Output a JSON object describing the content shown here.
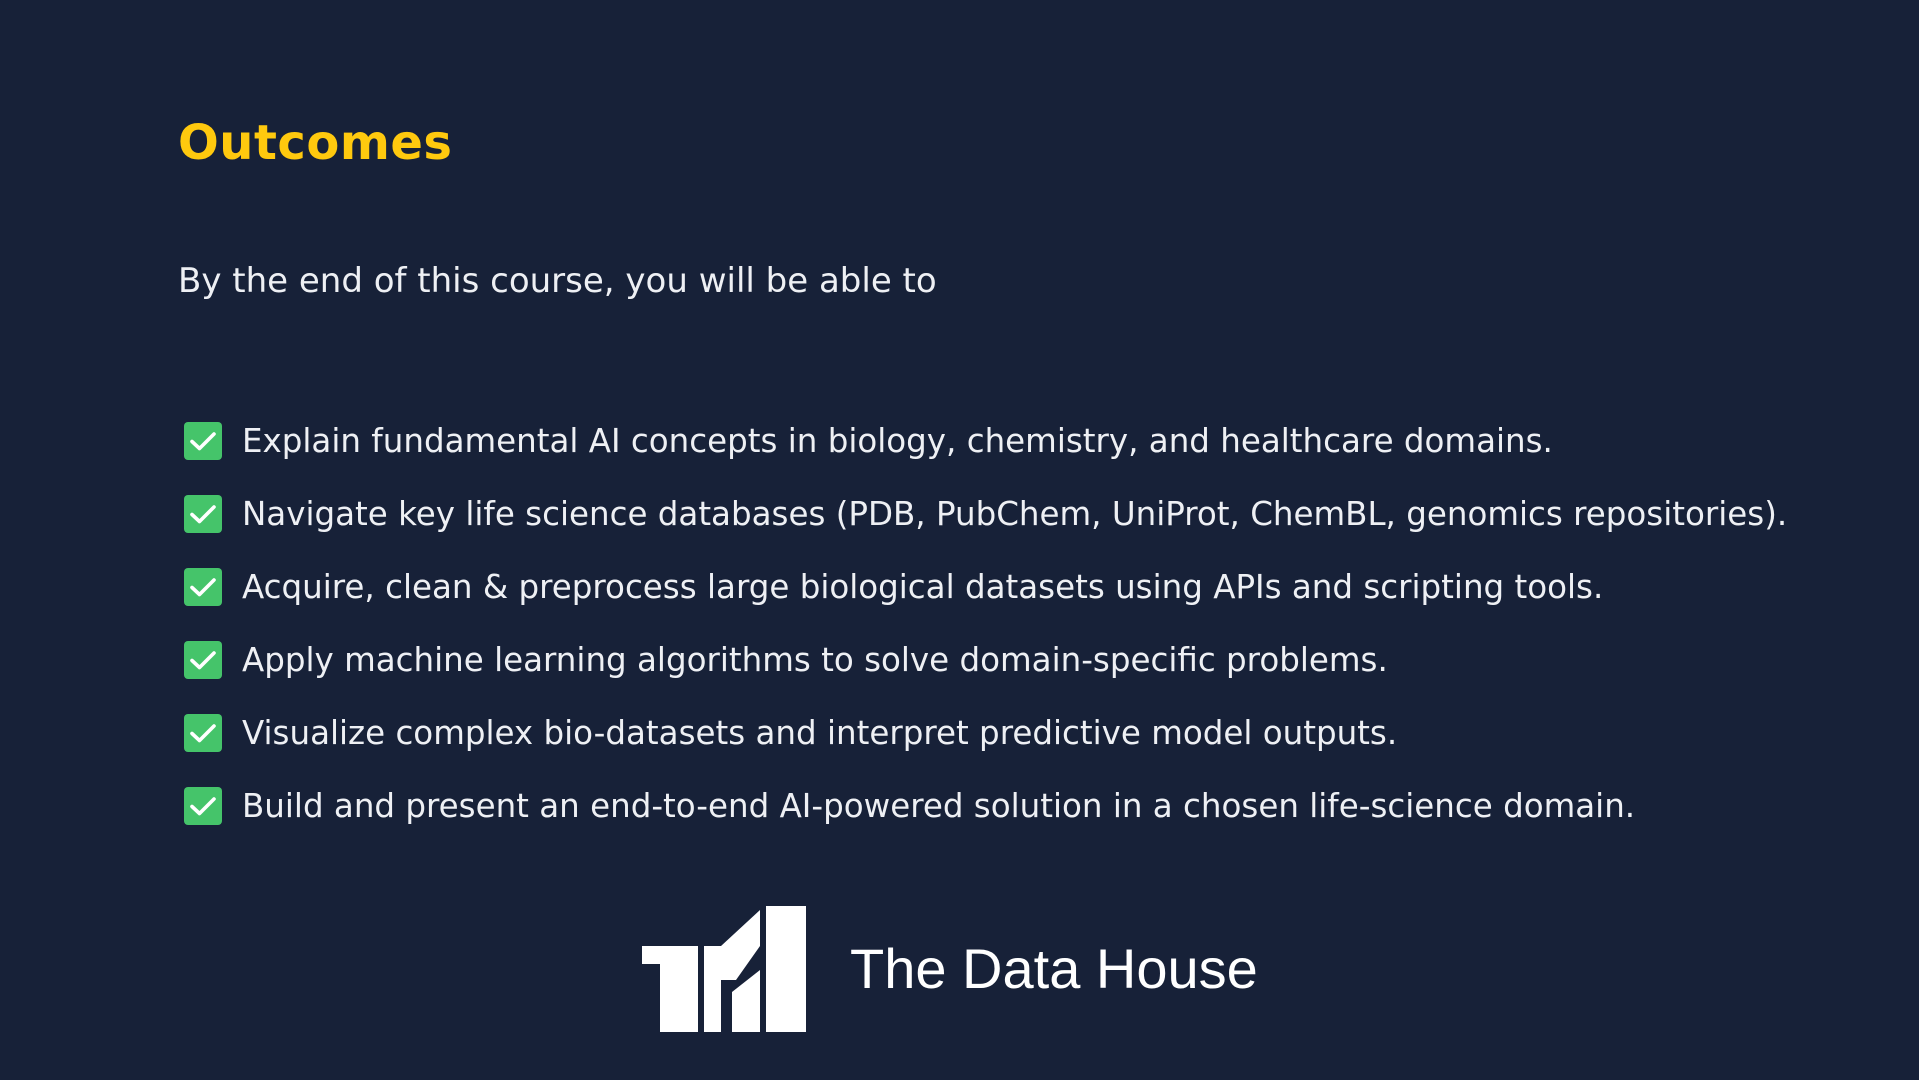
{
  "slide": {
    "title": "Outcomes",
    "intro": "By the end of this course, you will be able to",
    "outcomes": [
      {
        "icon": "check-icon",
        "text": "Explain fundamental AI concepts in biology, chemistry, and healthcare domains."
      },
      {
        "icon": "check-icon",
        "text": "Navigate key life science databases (PDB, PubChem, UniProt, ChemBL, genomics repositories)."
      },
      {
        "icon": "check-icon",
        "text": "Acquire, clean & preprocess large biological datasets using APIs and scripting tools."
      },
      {
        "icon": "check-icon",
        "text": "Apply machine learning algorithms to solve domain-specific problems."
      },
      {
        "icon": "check-icon",
        "text": "Visualize complex bio-datasets and interpret predictive model outputs."
      },
      {
        "icon": "check-icon",
        "text": "Build and present an end-to-end AI-powered solution in a chosen life-science domain."
      }
    ]
  },
  "brand": {
    "logo_icon": "the-data-house-logo",
    "name": "The Data House"
  },
  "colors": {
    "background": "#172138",
    "title": "#ffc90e",
    "text": "#eef0f4",
    "check": "#45c46a",
    "brand": "#ffffff"
  }
}
